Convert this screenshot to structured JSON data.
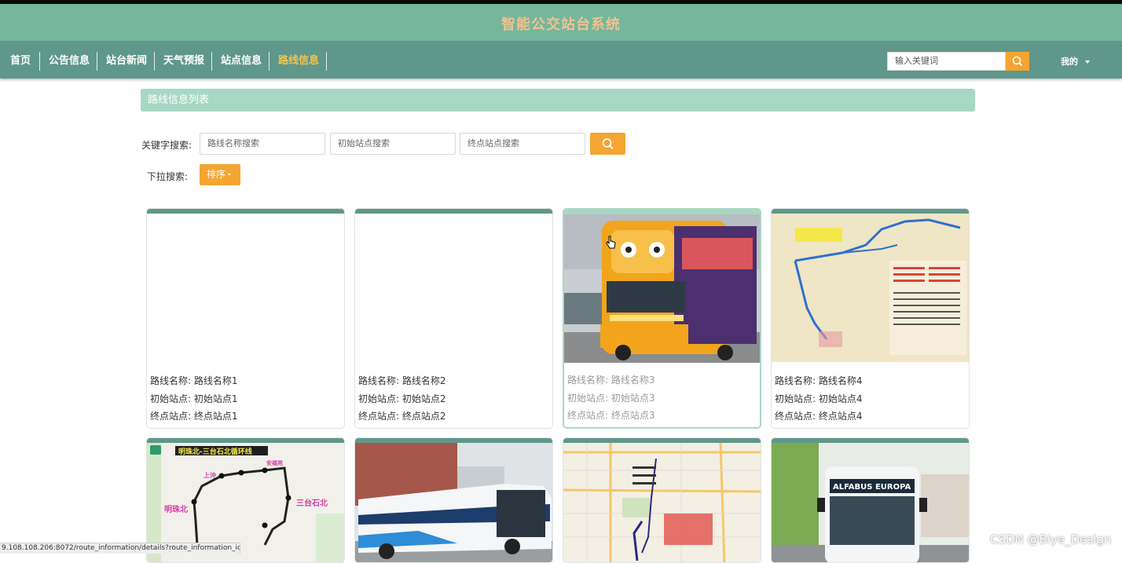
{
  "app": {
    "title": "智能公交站台系统"
  },
  "nav": {
    "items": [
      {
        "label": "首页",
        "active": false
      },
      {
        "label": "公告信息",
        "active": false
      },
      {
        "label": "站台新闻",
        "active": false
      },
      {
        "label": "天气预报",
        "active": false
      },
      {
        "label": "站点信息",
        "active": false
      },
      {
        "label": "路线信息",
        "active": true
      }
    ],
    "search_placeholder": "输入关键词",
    "mine_label": "我的"
  },
  "list": {
    "title": "路线信息列表",
    "keyword_label": "关键字搜索:",
    "route_name_placeholder": "路线名称搜索",
    "start_placeholder": "初始站点搜索",
    "end_placeholder": "终点站点搜索",
    "dropdown_label": "下拉搜索:",
    "sort_label": "排序"
  },
  "cards": [
    {
      "name_label": "路线名称:",
      "name": "路线名称1",
      "start_label": "初始站点:",
      "start": "初始站点1",
      "end_label": "终点站点:",
      "end": "终点站点1",
      "image": "blank"
    },
    {
      "name_label": "路线名称:",
      "name": "路线名称2",
      "start_label": "初始站点:",
      "start": "初始站点2",
      "end_label": "终点站点:",
      "end": "终点站点2",
      "image": "blank"
    },
    {
      "name_label": "路线名称:",
      "name": "路线名称3",
      "start_label": "初始站点:",
      "start": "初始站点3",
      "end_label": "终点站点:",
      "end": "终点站点3",
      "image": "double-decker-bus-photo"
    },
    {
      "name_label": "路线名称:",
      "name": "路线名称4",
      "start_label": "初始站点:",
      "start": "初始站点4",
      "end_label": "终点站点:",
      "end": "终点站点4",
      "image": "route-map"
    },
    {
      "image": "loop-route-map",
      "map_title": "明珠北-三台石北循环线",
      "labels": [
        "明珠北",
        "三台石北",
        "上沖",
        "安福苑"
      ]
    },
    {
      "image": "electric-bus-photo"
    },
    {
      "image": "street-route-map"
    },
    {
      "image": "alfabus-photo",
      "bus_sign": "ALFABUS EUROPA"
    }
  ],
  "status_url": "9.108.108.206:8072/route_information/details?route_information_id=3",
  "watermark": "CSDN @Biye_Design"
}
